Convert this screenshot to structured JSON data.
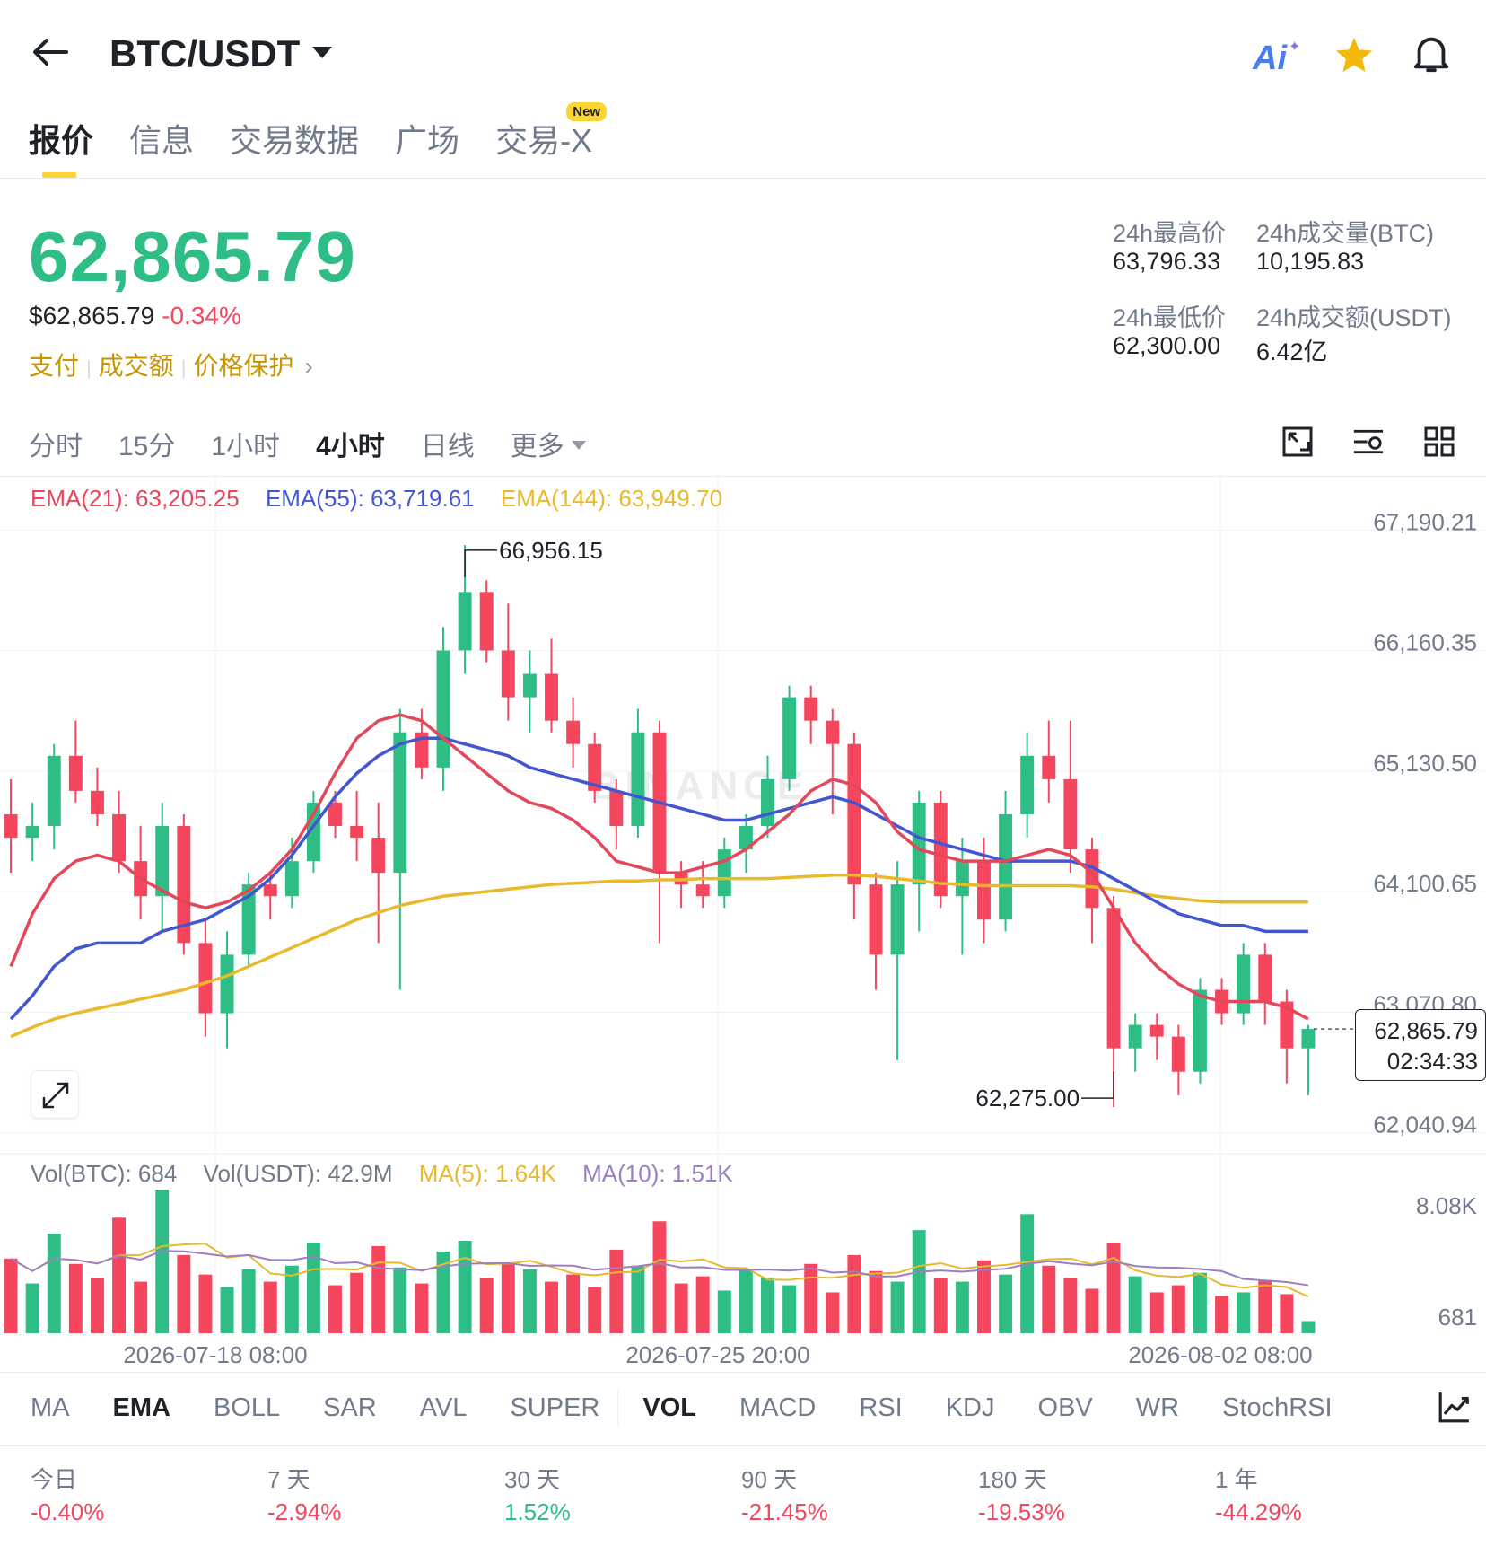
{
  "header": {
    "title": "BTC/USDT",
    "ai_label": "Ai"
  },
  "tabs": [
    {
      "label": "报价",
      "active": true
    },
    {
      "label": "信息"
    },
    {
      "label": "交易数据"
    },
    {
      "label": "广场"
    },
    {
      "label": "交易-X",
      "badge": "New"
    }
  ],
  "ticker": {
    "last_price": "62,865.79",
    "usd_price": "$62,865.79",
    "change_pct": "-0.34%",
    "links": [
      "支付",
      "成交额",
      "价格保护"
    ],
    "high_label": "24h最高价",
    "high_value": "63,796.33",
    "vol_btc_label": "24h成交量(BTC)",
    "vol_btc_value": "10,195.83",
    "low_label": "24h最低价",
    "low_value": "62,300.00",
    "vol_usdt_label": "24h成交额(USDT)",
    "vol_usdt_value": "6.42亿"
  },
  "intervals": [
    {
      "label": "分时"
    },
    {
      "label": "15分"
    },
    {
      "label": "1小时"
    },
    {
      "label": "4小时",
      "active": true
    },
    {
      "label": "日线"
    },
    {
      "label": "更多"
    }
  ],
  "ema_legend": {
    "ema21": "EMA(21): 63,205.25",
    "ema55": "EMA(55): 63,719.61",
    "ema144": "EMA(144): 63,949.70"
  },
  "price_axis": [
    "67,190.21",
    "66,160.35",
    "65,130.50",
    "64,100.65",
    "63,070.80",
    "62,040.94"
  ],
  "annotations": {
    "high": "66,956.15",
    "low": "62,275.00",
    "current_price": "62,865.79",
    "countdown": "02:34:33",
    "watermark": "BINANCE"
  },
  "vol_legend": {
    "vol_btc": "Vol(BTC): 684",
    "vol_usdt": "Vol(USDT): 42.9M",
    "ma5": "MA(5): 1.64K",
    "ma10": "MA(10): 1.51K"
  },
  "vol_axis": [
    "8.08K",
    "681"
  ],
  "time_axis": [
    "2026-07-18 08:00",
    "2026-07-25 20:00",
    "2026-08-02 08:00"
  ],
  "indicators": [
    {
      "label": "MA"
    },
    {
      "label": "EMA",
      "active": true
    },
    {
      "label": "BOLL"
    },
    {
      "label": "SAR"
    },
    {
      "label": "AVL"
    },
    {
      "label": "SUPER"
    },
    {
      "label": "VOL",
      "active": true
    },
    {
      "label": "MACD"
    },
    {
      "label": "RSI"
    },
    {
      "label": "KDJ"
    },
    {
      "label": "OBV"
    },
    {
      "label": "WR"
    },
    {
      "label": "StochRSI"
    }
  ],
  "performance": [
    {
      "label": "今日",
      "value": "-0.40%",
      "dir": "down"
    },
    {
      "label": "7 天",
      "value": "-2.94%",
      "dir": "down"
    },
    {
      "label": "30 天",
      "value": "1.52%",
      "dir": "up"
    },
    {
      "label": "90 天",
      "value": "-21.45%",
      "dir": "down"
    },
    {
      "label": "180 天",
      "value": "-19.53%",
      "dir": "down"
    },
    {
      "label": "1 年",
      "value": "-44.29%",
      "dir": "down"
    }
  ],
  "colors": {
    "up": "#2ebd85",
    "down": "#f6465d",
    "accent": "#fcd535",
    "ema21": "#e5475a",
    "ema55": "#4256d0",
    "ema144": "#e8b92c",
    "ma5": "#e8b92c",
    "ma10": "#9b7fc2"
  },
  "icons": [
    "back-arrow-icon",
    "ai-icon",
    "star-icon",
    "bell-icon",
    "chart-settings-icon",
    "indicator-settings-icon",
    "grid-layout-icon",
    "expand-icon",
    "line-chart-icon"
  ],
  "chart_data": {
    "type": "candlestick",
    "interval": "4小时",
    "y_range": [
      61800,
      67400
    ],
    "x_labels": [
      "2026-07-18 08:00",
      "2026-07-25 20:00",
      "2026-08-02 08:00"
    ],
    "marked_high": 66956.15,
    "marked_low": 62275.0,
    "last": 62865.79,
    "candles": [
      [
        64700,
        65000,
        64200,
        64500
      ],
      [
        64500,
        64800,
        64300,
        64600
      ],
      [
        64600,
        65300,
        64400,
        65200
      ],
      [
        65200,
        65500,
        64800,
        64900
      ],
      [
        64900,
        65100,
        64600,
        64700
      ],
      [
        64700,
        64900,
        64200,
        64300
      ],
      [
        64300,
        64600,
        63800,
        64000
      ],
      [
        64000,
        64800,
        63700,
        64600
      ],
      [
        64600,
        64700,
        63500,
        63600
      ],
      [
        63600,
        63800,
        62800,
        63000
      ],
      [
        63000,
        63700,
        62700,
        63500
      ],
      [
        63500,
        64200,
        63400,
        64100
      ],
      [
        64100,
        64200,
        63800,
        64000
      ],
      [
        64000,
        64500,
        63900,
        64300
      ],
      [
        64300,
        64900,
        64200,
        64800
      ],
      [
        64800,
        64900,
        64500,
        64600
      ],
      [
        64600,
        64900,
        64300,
        64500
      ],
      [
        64500,
        64800,
        63600,
        64200
      ],
      [
        64200,
        65600,
        63200,
        65400
      ],
      [
        65400,
        65600,
        65000,
        65100
      ],
      [
        65100,
        66300,
        64900,
        66100
      ],
      [
        66100,
        67000,
        65900,
        66600
      ],
      [
        66600,
        66700,
        66000,
        66100
      ],
      [
        66100,
        66500,
        65500,
        65700
      ],
      [
        65700,
        66100,
        65400,
        65900
      ],
      [
        65900,
        66200,
        65400,
        65500
      ],
      [
        65500,
        65700,
        65100,
        65300
      ],
      [
        65300,
        65400,
        64800,
        64900
      ],
      [
        64900,
        65000,
        64400,
        64600
      ],
      [
        64600,
        65600,
        64500,
        65400
      ],
      [
        65400,
        65500,
        63600,
        64200
      ],
      [
        64200,
        64300,
        63900,
        64100
      ],
      [
        64100,
        64300,
        63900,
        64000
      ],
      [
        64000,
        64500,
        63900,
        64400
      ],
      [
        64400,
        64700,
        64200,
        64600
      ],
      [
        64600,
        65200,
        64500,
        65000
      ],
      [
        65000,
        65800,
        64900,
        65700
      ],
      [
        65700,
        65800,
        65300,
        65500
      ],
      [
        65500,
        65600,
        64700,
        65300
      ],
      [
        65300,
        65400,
        63800,
        64100
      ],
      [
        64100,
        64200,
        63200,
        63500
      ],
      [
        63500,
        64300,
        62600,
        64100
      ],
      [
        64100,
        64900,
        63700,
        64800
      ],
      [
        64800,
        64900,
        63900,
        64000
      ],
      [
        64000,
        64500,
        63500,
        64300
      ],
      [
        64300,
        64500,
        63600,
        63800
      ],
      [
        63800,
        64900,
        63700,
        64700
      ],
      [
        64700,
        65400,
        64500,
        65200
      ],
      [
        65200,
        65500,
        64800,
        65000
      ],
      [
        65000,
        65500,
        64200,
        64400
      ],
      [
        64400,
        64500,
        63600,
        63900
      ],
      [
        63900,
        64000,
        62200,
        62700
      ],
      [
        62700,
        63000,
        62500,
        62900
      ],
      [
        62900,
        63000,
        62600,
        62800
      ],
      [
        62800,
        62900,
        62300,
        62500
      ],
      [
        62500,
        63300,
        62400,
        63200
      ],
      [
        63200,
        63300,
        62900,
        63000
      ],
      [
        63000,
        63600,
        62900,
        63500
      ],
      [
        63500,
        63600,
        62900,
        63100
      ],
      [
        63100,
        63200,
        62400,
        62700
      ],
      [
        62700,
        62900,
        62300,
        62866
      ]
    ],
    "volume": [
      4200,
      2800,
      5600,
      3900,
      3100,
      6500,
      2900,
      8080,
      4400,
      3300,
      2600,
      3600,
      2900,
      3800,
      5100,
      2700,
      3400,
      4900,
      3700,
      2800,
      4600,
      5200,
      3100,
      3900,
      3600,
      2900,
      3300,
      2600,
      4700,
      3800,
      6300,
      2800,
      3200,
      2400,
      3600,
      3100,
      2700,
      3900,
      2300,
      4400,
      3500,
      2900,
      5800,
      3100,
      2900,
      4100,
      3300,
      6700,
      3800,
      3100,
      2500,
      5100,
      3200,
      2300,
      2700,
      3400,
      2100,
      2300,
      3000,
      2200,
      684
    ],
    "ema21": [
      63400,
      63850,
      64150,
      64300,
      64350,
      64300,
      64150,
      64050,
      63950,
      63900,
      63950,
      64050,
      64200,
      64400,
      64700,
      65050,
      65350,
      65500,
      65550,
      65500,
      65350,
      65200,
      65050,
      64900,
      64800,
      64750,
      64650,
      64500,
      64300,
      64250,
      64200,
      64200,
      64250,
      64300,
      64400,
      64550,
      64700,
      64900,
      65000,
      64950,
      64800,
      64550,
      64400,
      64350,
      64300,
      64300,
      64300,
      64350,
      64400,
      64350,
      64200,
      63900,
      63600,
      63400,
      63250,
      63150,
      63100,
      63100,
      63100,
      63050,
      62950
    ],
    "ema55": [
      62950,
      63150,
      63400,
      63550,
      63600,
      63600,
      63600,
      63700,
      63750,
      63800,
      63900,
      64000,
      64150,
      64350,
      64600,
      64850,
      65050,
      65200,
      65300,
      65350,
      65350,
      65300,
      65250,
      65200,
      65100,
      65050,
      65000,
      64950,
      64900,
      64850,
      64800,
      64750,
      64700,
      64650,
      64650,
      64700,
      64750,
      64800,
      64850,
      64800,
      64700,
      64600,
      64500,
      64450,
      64400,
      64350,
      64300,
      64300,
      64300,
      64300,
      64250,
      64150,
      64050,
      63950,
      63850,
      63800,
      63750,
      63750,
      63700,
      63700,
      63700
    ],
    "ema144": [
      62800,
      62880,
      62950,
      63000,
      63040,
      63080,
      63120,
      63160,
      63200,
      63260,
      63320,
      63400,
      63480,
      63560,
      63640,
      63720,
      63800,
      63860,
      63920,
      63960,
      64000,
      64020,
      64040,
      64060,
      64080,
      64100,
      64110,
      64120,
      64130,
      64130,
      64140,
      64140,
      64150,
      64150,
      64150,
      64150,
      64160,
      64170,
      64180,
      64180,
      64170,
      64150,
      64130,
      64110,
      64100,
      64090,
      64090,
      64090,
      64090,
      64090,
      64080,
      64060,
      64030,
      64000,
      63980,
      63960,
      63950,
      63950,
      63950,
      63950,
      63950
    ]
  }
}
